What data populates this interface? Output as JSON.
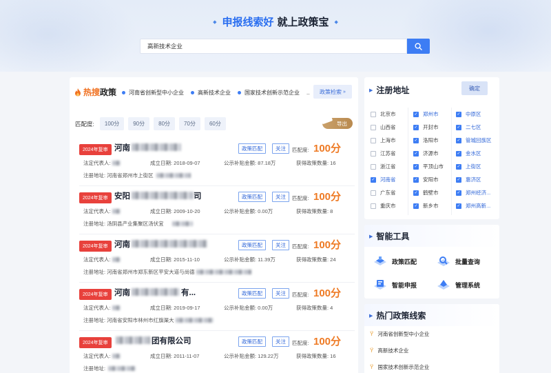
{
  "hero": {
    "slogan_part1": "申报线索好",
    "slogan_part2": "就上政策宝",
    "search_value": "高新技术企业"
  },
  "hot": {
    "title_orange": "热搜",
    "title_dark": "政策",
    "tags": [
      "河南省创新型中小企业",
      "高新技术企业",
      "国家技术创新示范企业"
    ],
    "more": "..",
    "policy_search": "政策检索"
  },
  "match": {
    "label": "匹配度:",
    "chips": [
      "100分",
      "90分",
      "80分",
      "70分",
      "60分"
    ],
    "export": "导出"
  },
  "companies": [
    {
      "badge": "2024年复审",
      "name": "河南",
      "name_suffix": "",
      "match_btn": "政策匹配",
      "follow_btn": "关注",
      "score_label": "匹配度:",
      "score": "100分",
      "rep": "法定代表人:",
      "founded": "成立日期: 2018-09-07",
      "subsidy": "公示补贴金额: 87.18万",
      "policies": "获得政策数量: 16",
      "address": "注册地址: 河南省郑州市上街区"
    },
    {
      "badge": "2024年复审",
      "name": "安阳",
      "name_suffix": "司",
      "match_btn": "政策匹配",
      "follow_btn": "关注",
      "score_label": "匹配度:",
      "score": "100分",
      "rep": "法定代表人:",
      "founded": "成立日期: 2009-10-20",
      "subsidy": "公示补贴金额: 0.00万",
      "policies": "获得政策数量: 8",
      "address": "注册地址: 汤阴县产业集聚区汤伏宜"
    },
    {
      "badge": "2024年复审",
      "name": "河南",
      "name_suffix": "",
      "match_btn": "政策匹配",
      "follow_btn": "关注",
      "score_label": "匹配度:",
      "score": "100分",
      "rep": "法定代表人:",
      "founded": "成立日期: 2015-11-10",
      "subsidy": "公示补贴金额: 11.39万",
      "policies": "获得政策数量: 24",
      "address": "注册地址: 河南省郑州市郑东新区平安大道与尚德"
    },
    {
      "badge": "2024年复审",
      "name": "河南",
      "name_suffix": "有...",
      "match_btn": "政策匹配",
      "follow_btn": "关注",
      "score_label": "匹配度:",
      "score": "100分",
      "rep": "法定代表人:",
      "founded": "成立日期: 2019-09-17",
      "subsidy": "公示补贴金额: 0.00万",
      "policies": "获得政策数量: 4",
      "address": "注册地址: 河南省安阳市林州市红旗渠大"
    },
    {
      "badge": "2024年复审",
      "name": "",
      "name_suffix": "团有限公司",
      "match_btn": "政策匹配",
      "follow_btn": "关注",
      "score_label": "匹配度:",
      "score": "100分",
      "rep": "法定代表人:",
      "founded": "成立日期: 2011-11-07",
      "subsidy": "公示补贴金额: 129.22万",
      "policies": "获得政策数量: 16",
      "address": "注册地址:"
    }
  ],
  "region": {
    "title": "注册地址",
    "confirm": "确定",
    "provinces": [
      {
        "label": "北京市",
        "checked": false
      },
      {
        "label": "山西省",
        "checked": false
      },
      {
        "label": "上海市",
        "checked": false
      },
      {
        "label": "江苏省",
        "checked": false
      },
      {
        "label": "浙江省",
        "checked": false
      },
      {
        "label": "河南省",
        "checked": true
      },
      {
        "label": "广东省",
        "checked": false
      },
      {
        "label": "重庆市",
        "checked": false
      }
    ],
    "cities": [
      {
        "label": "郑州市",
        "checked": true
      },
      {
        "label": "开封市",
        "checked": true
      },
      {
        "label": "洛阳市",
        "checked": true
      },
      {
        "label": "济源市",
        "checked": true
      },
      {
        "label": "平顶山市",
        "checked": true
      },
      {
        "label": "安阳市",
        "checked": true
      },
      {
        "label": "鹤壁市",
        "checked": true
      },
      {
        "label": "新乡市",
        "checked": true
      }
    ],
    "districts": [
      {
        "label": "中原区",
        "checked": true
      },
      {
        "label": "二七区",
        "checked": true
      },
      {
        "label": "管城回族区",
        "checked": true
      },
      {
        "label": "金水区",
        "checked": true
      },
      {
        "label": "上街区",
        "checked": true
      },
      {
        "label": "惠济区",
        "checked": true
      },
      {
        "label": "郑州经济...",
        "checked": true
      },
      {
        "label": "郑州高新...",
        "checked": true
      }
    ]
  },
  "tools": {
    "title": "智能工具",
    "items": [
      "政策匹配",
      "批量查询",
      "智能申报",
      "管理系统"
    ]
  },
  "leads": {
    "title": "热门政策线索",
    "items": [
      "河南省创新型中小企业",
      "高新技术企业",
      "国家技术创新示范企业"
    ]
  },
  "colors": {
    "primary": "#3d7df4",
    "score_orange": "#ee7a24",
    "badge_red": "#e8413c",
    "hot_orange": "#f07020"
  }
}
